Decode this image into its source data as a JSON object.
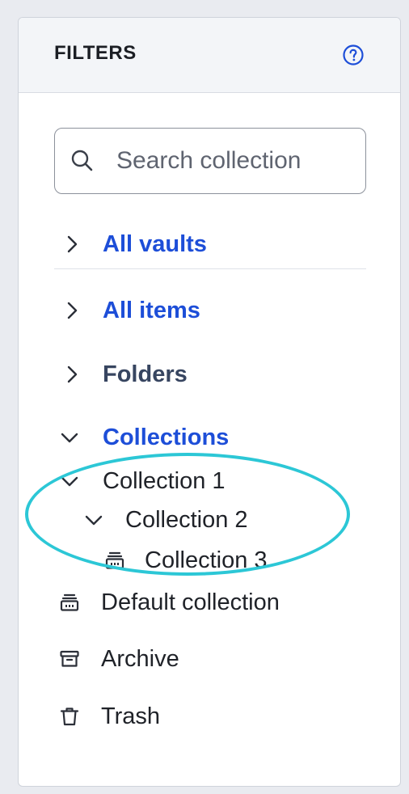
{
  "panel": {
    "title": "FILTERS",
    "help_icon": "question-circle-icon"
  },
  "search": {
    "placeholder": "Search collection",
    "value": ""
  },
  "sections": {
    "all_vaults": "All vaults",
    "all_items": "All items",
    "folders": "Folders",
    "collections": "Collections"
  },
  "collections": {
    "collection_1": "Collection 1",
    "collection_2": "Collection 2",
    "collection_3": "Collection 3",
    "default_collection": "Default collection"
  },
  "other": {
    "archive": "Archive",
    "trash": "Trash"
  },
  "colors": {
    "accent": "#1d4ed8",
    "highlight": "#2cc7d6",
    "header_bg": "#f3f5f8"
  }
}
